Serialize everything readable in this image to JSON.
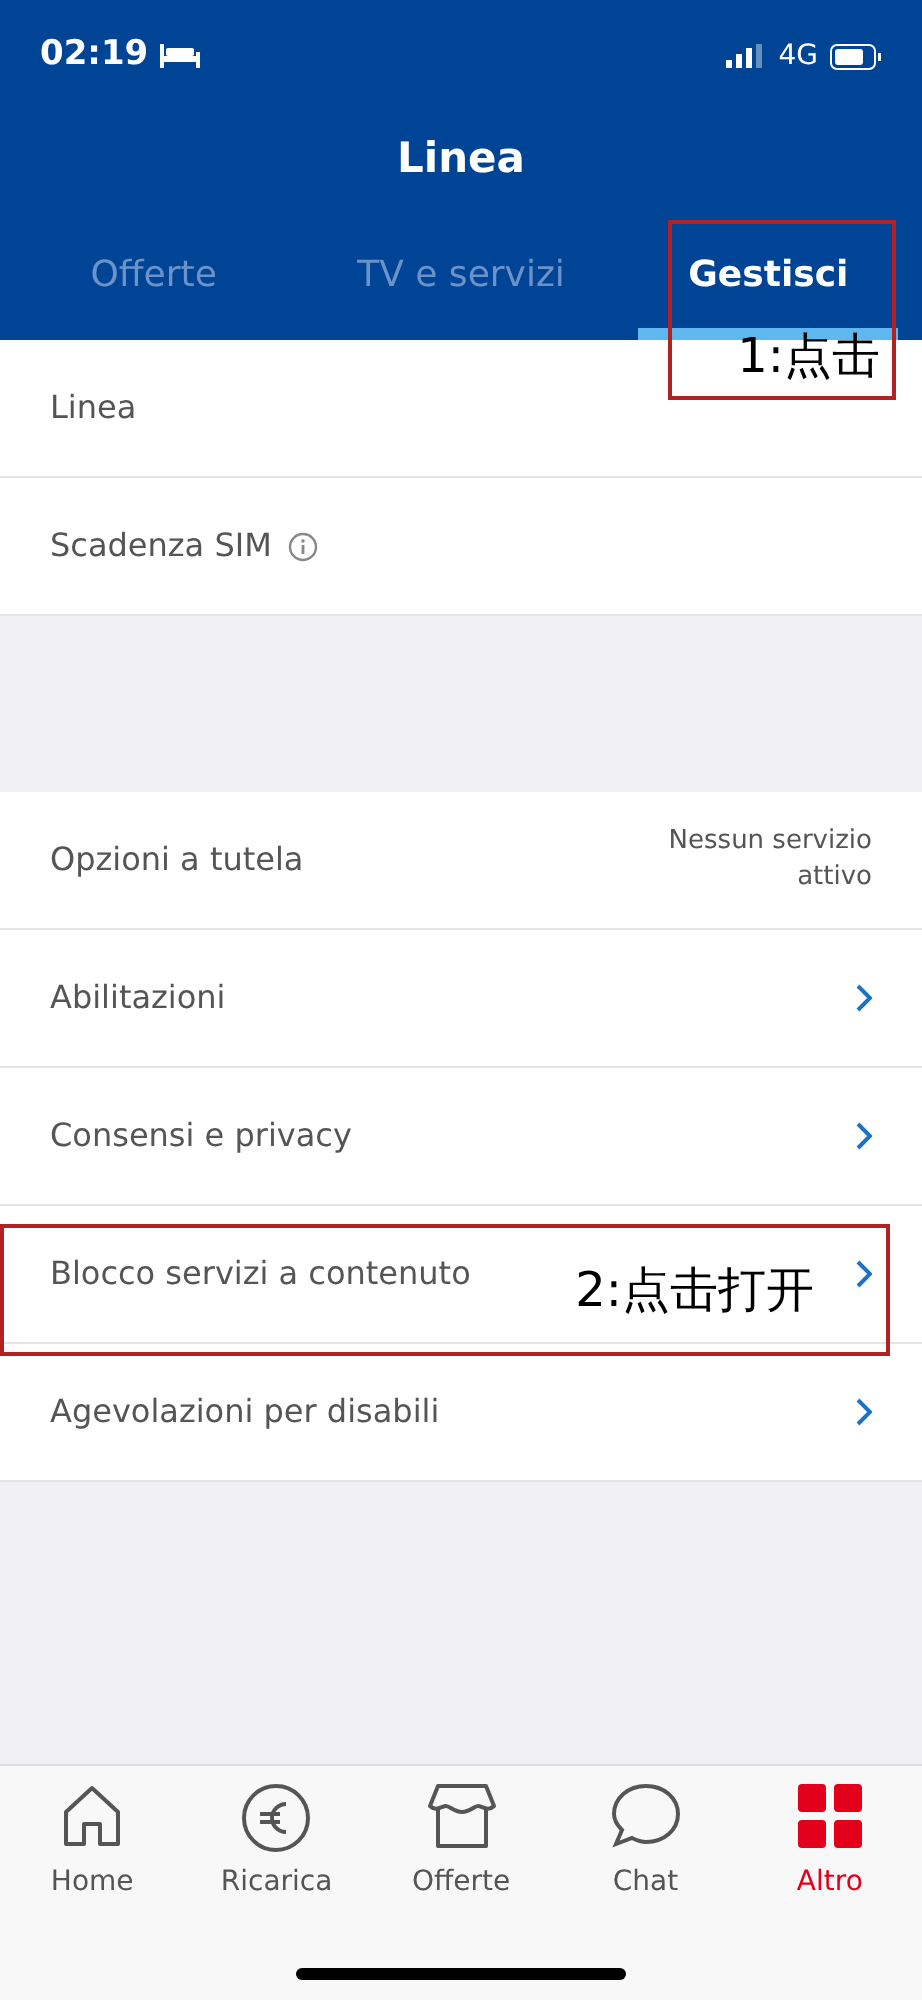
{
  "status_bar": {
    "time": "02:19",
    "network": "4G"
  },
  "header": {
    "title": "Linea"
  },
  "tabs": [
    {
      "label": "Offerte",
      "selected": false
    },
    {
      "label": "TV e servizi",
      "selected": false
    },
    {
      "label": "Gestisci",
      "selected": true
    }
  ],
  "sections": [
    {
      "rows": [
        {
          "kind": "plain",
          "label": "Linea"
        },
        {
          "kind": "info",
          "label": "Scadenza SIM"
        }
      ]
    },
    {
      "rows": [
        {
          "kind": "value",
          "label": "Opzioni a tutela",
          "value": "Nessun servizio attivo"
        },
        {
          "kind": "link",
          "label": "Abilitazioni"
        },
        {
          "kind": "link",
          "label": "Consensi e privacy"
        },
        {
          "kind": "link",
          "label": "Blocco servizi a contenuto"
        },
        {
          "kind": "link",
          "label": "Agevolazioni per disabili"
        }
      ]
    }
  ],
  "annotations": [
    {
      "kind": "tab",
      "text": "1:点击"
    },
    {
      "kind": "row",
      "text": "2:点击打开"
    }
  ],
  "bottom_nav": [
    {
      "label": "Home",
      "selected": false
    },
    {
      "label": "Ricarica",
      "selected": false
    },
    {
      "label": "Offerte",
      "selected": false
    },
    {
      "label": "Chat",
      "selected": false
    },
    {
      "label": "Altro",
      "selected": true
    }
  ]
}
